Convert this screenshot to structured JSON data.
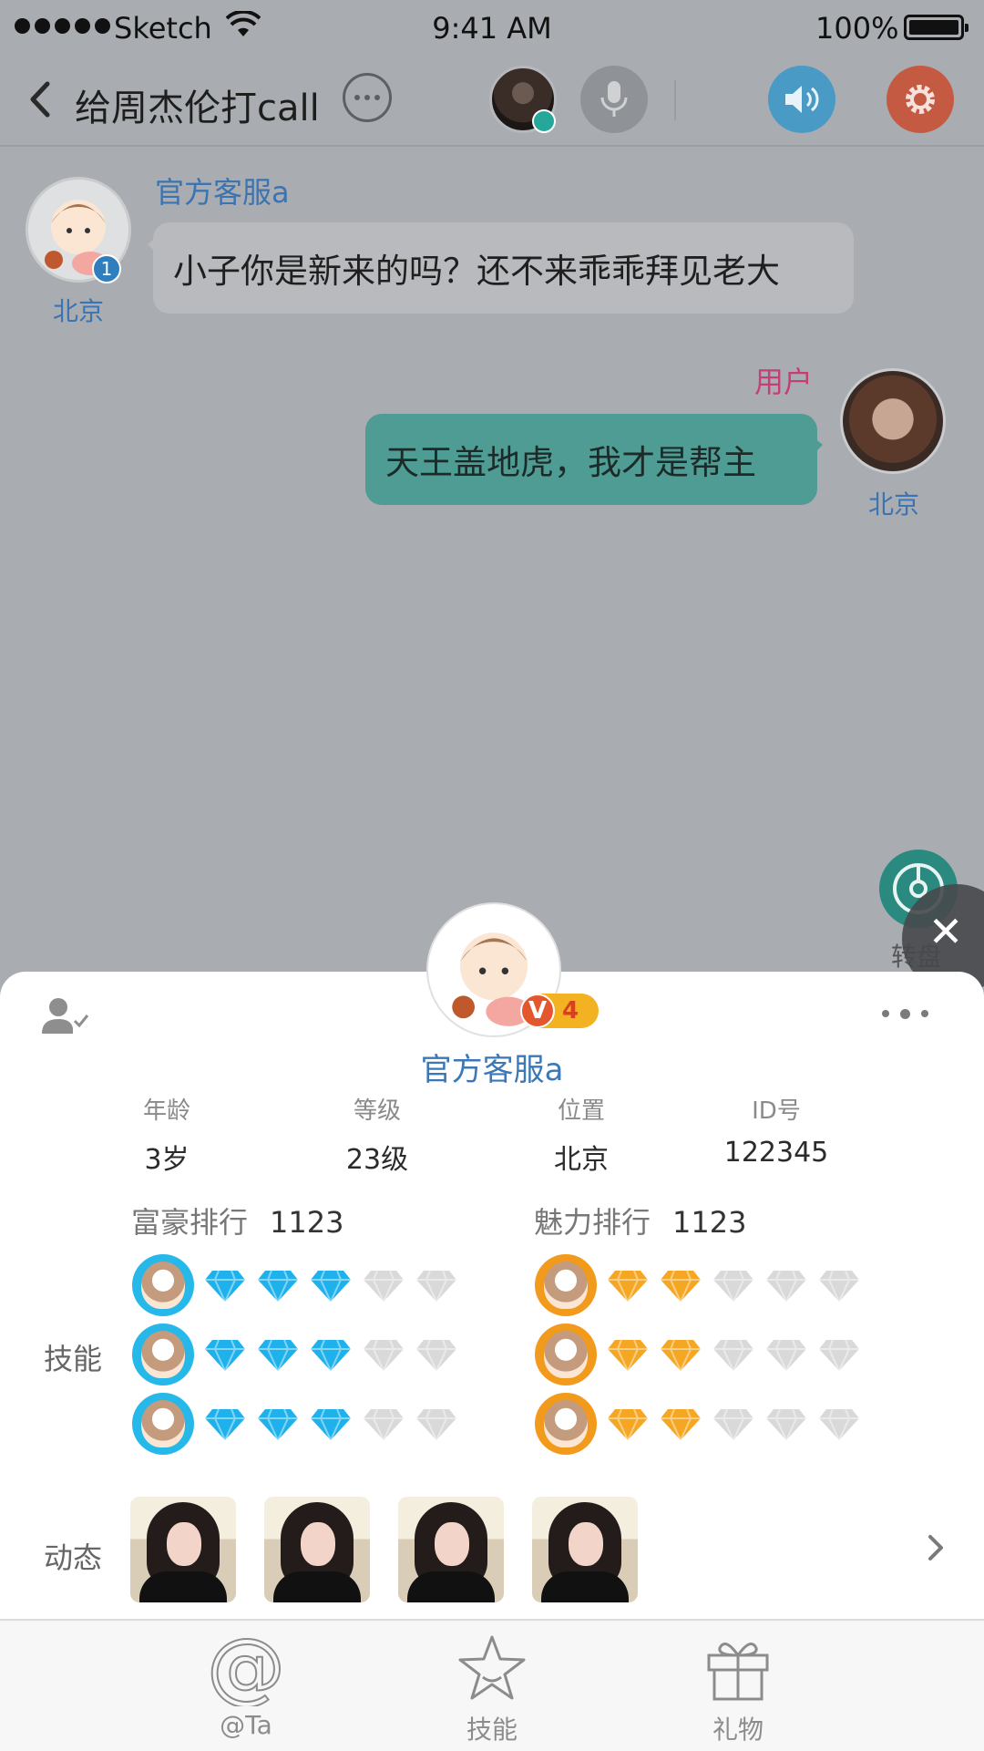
{
  "status_bar": {
    "carrier": "Sketch",
    "time": "9:41 AM",
    "battery": "100%"
  },
  "nav": {
    "title": "给周杰伦打call"
  },
  "messages": [
    {
      "sender": "官方客服a",
      "text": "小子你是新来的吗？还不来乖乖拜见老大",
      "location": "北京",
      "badge": "1"
    },
    {
      "sender": "用户",
      "text": "天王盖地虎，我才是帮主",
      "location": "北京"
    }
  ],
  "roulette": {
    "label": "转盘"
  },
  "profile": {
    "name": "官方客服a",
    "vip_level": "4",
    "vip_mark": "V",
    "stats": [
      {
        "label": "年龄",
        "value": "3岁"
      },
      {
        "label": "等级",
        "value": "23级"
      },
      {
        "label": "位置",
        "value": "北京"
      },
      {
        "label": "ID号",
        "value": "122345"
      }
    ],
    "rich_rank": {
      "label": "富豪排行",
      "value": "1123"
    },
    "charm_rank": {
      "label": "魅力排行",
      "value": "1123"
    },
    "skills_label": "技能",
    "skills_left": [
      {
        "filled": 3,
        "total": 5
      },
      {
        "filled": 3,
        "total": 5
      },
      {
        "filled": 3,
        "total": 5
      }
    ],
    "skills_right": [
      {
        "filled": 2,
        "total": 5
      },
      {
        "filled": 2,
        "total": 5
      },
      {
        "filled": 2,
        "total": 5
      }
    ],
    "moments_label": "动态"
  },
  "tabs": [
    {
      "label": "@Ta",
      "icon": "at-icon"
    },
    {
      "label": "技能",
      "icon": "star-icon"
    },
    {
      "label": "礼物",
      "icon": "gift-icon"
    }
  ],
  "colors": {
    "link_blue": "#3b74b0",
    "user_pink": "#c63d78",
    "teal": "#4e9c93",
    "gem_blue": "#1fb1ec",
    "gem_orange": "#f5a623",
    "gem_empty": "#d9d9d9"
  }
}
